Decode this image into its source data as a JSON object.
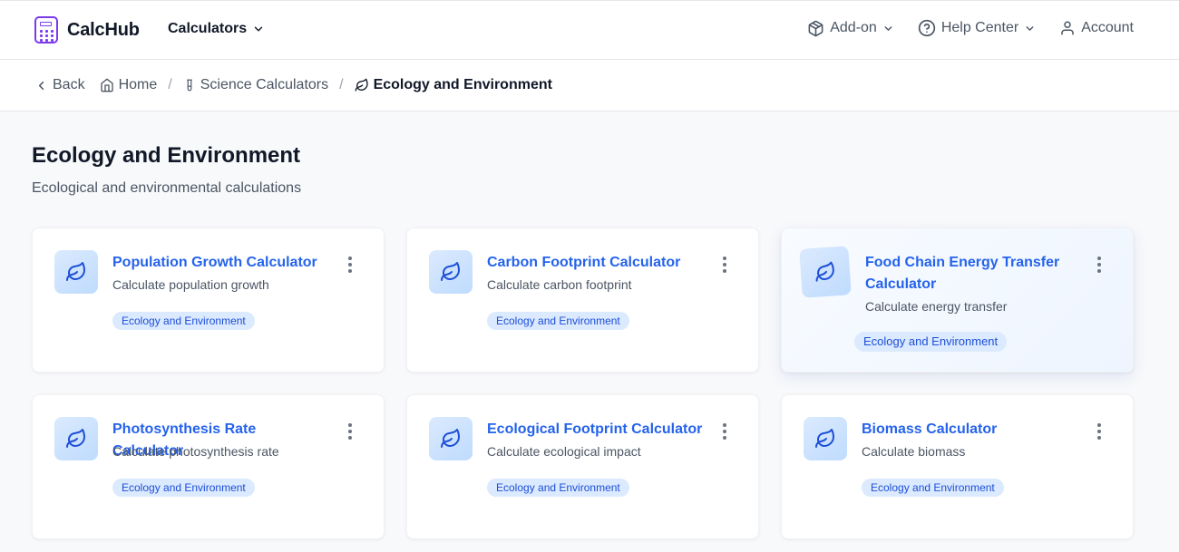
{
  "app": {
    "name": "CalcHub",
    "nav_calculators": "Calculators",
    "addon": "Add-on",
    "help_center": "Help Center",
    "account": "Account"
  },
  "breadcrumb": {
    "back": "Back",
    "home": "Home",
    "science": "Science Calculators",
    "current": "Ecology and Environment"
  },
  "page": {
    "title": "Ecology and Environment",
    "subtitle": "Ecological and environmental calculations"
  },
  "cards": [
    {
      "title": "Population Growth Calculator",
      "desc": "Calculate population growth",
      "badge": "Ecology and Environment"
    },
    {
      "title": "Carbon Footprint Calculator",
      "desc": "Calculate carbon footprint",
      "badge": "Ecology and Environment"
    },
    {
      "title": "Food Chain Energy Transfer Calculator",
      "desc": "Calculate energy transfer",
      "badge": "Ecology and Environment"
    },
    {
      "title": "Photosynthesis Rate Calculator",
      "desc": "Calculate photosynthesis rate",
      "badge": "Ecology and Environment"
    },
    {
      "title": "Ecological Footprint Calculator",
      "desc": "Calculate ecological impact",
      "badge": "Ecology and Environment"
    },
    {
      "title": "Biomass Calculator",
      "desc": "Calculate biomass",
      "badge": "Ecology and Environment"
    }
  ],
  "icons": {
    "logo": "calculator-icon",
    "card": "leaf-icon",
    "addon": "package-icon",
    "help": "help-circle-icon",
    "account": "user-icon"
  },
  "colors": {
    "brand": "#7c3aed",
    "link": "#2563eb",
    "badge_bg": "#dbeafe",
    "badge_text": "#1d4ed8"
  }
}
